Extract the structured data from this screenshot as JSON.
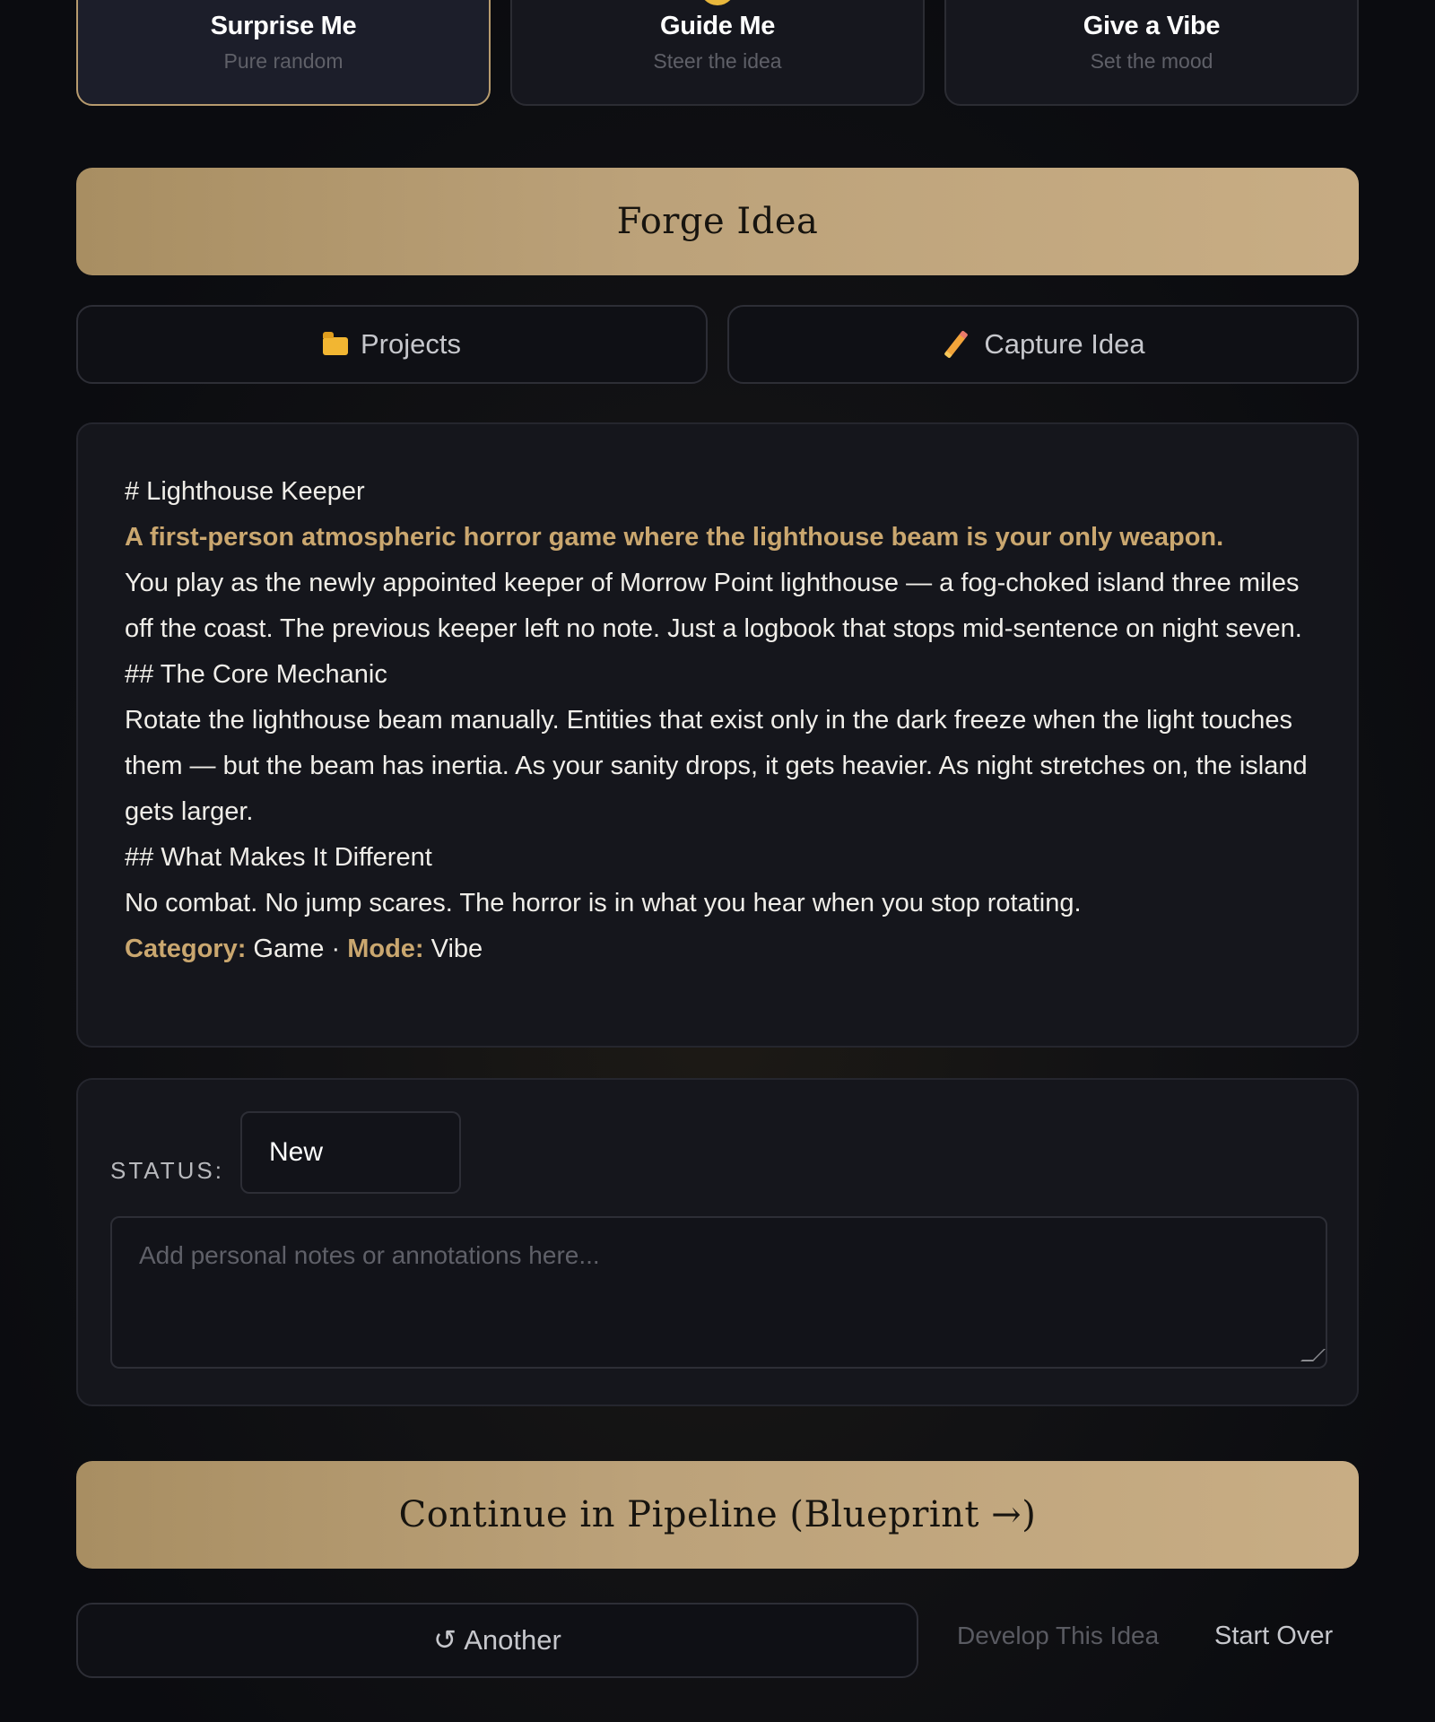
{
  "modes": [
    {
      "title": "Surprise Me",
      "subtitle": "Pure random",
      "active": true
    },
    {
      "title": "Guide Me",
      "subtitle": "Steer the idea",
      "active": false
    },
    {
      "title": "Give a Vibe",
      "subtitle": "Set the mood",
      "active": false
    }
  ],
  "actions": {
    "forge_label": "Forge Idea",
    "projects_label": "Projects",
    "capture_label": "Capture Idea"
  },
  "idea": {
    "heading": "# Lighthouse Keeper",
    "tagline": "A first-person atmospheric horror game where the lighthouse beam is your only weapon.",
    "intro": "You play as the newly appointed keeper of Morrow Point lighthouse — a fog-choked island three miles off the coast. The previous keeper left no note. Just a logbook that stops mid-sentence on night seven.",
    "section1_heading": "## The Core Mechanic",
    "section1_body": "Rotate the lighthouse beam manually. Entities that exist only in the dark freeze when the light touches them — but the beam has inertia. As your sanity drops, it gets heavier. As night stretches on, the island gets larger.",
    "section2_heading": "## What Makes It Different",
    "section2_body": "No combat. No jump scares. The horror is in what you hear when you stop rotating.",
    "category_label": "Category:",
    "category_value": "Game",
    "separator": "·",
    "mode_label": "Mode:",
    "mode_value": "Vibe"
  },
  "status": {
    "label": "STATUS:",
    "value": "New",
    "notes_value": "",
    "notes_placeholder": "Add personal notes or annotations here..."
  },
  "footer": {
    "pipeline_label": "Continue in Pipeline (Blueprint →)",
    "another_icon": "↺",
    "another_label": "Another",
    "develop_label": "Develop This Idea",
    "start_over_label": "Start Over"
  },
  "colors": {
    "accent_gold": "#caa76f",
    "background": "#0b0c10",
    "card": "#15161c"
  },
  "icons": {
    "projects": "folder-icon",
    "capture": "pencil-icon",
    "another": "refresh-icon"
  }
}
